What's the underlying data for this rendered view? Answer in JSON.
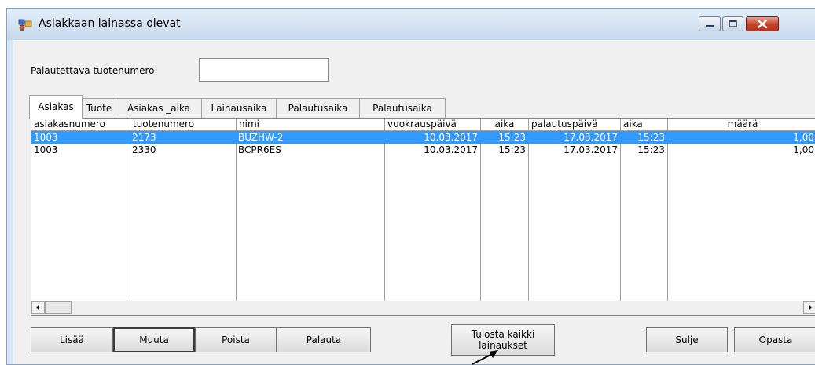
{
  "window": {
    "title": "Asiakkaan lainassa olevat",
    "app_icon": "people-icon",
    "controls": {
      "minimize": "minimize-icon",
      "maximize": "maximize-icon",
      "close": "close-icon"
    }
  },
  "product_input": {
    "label": "Palautettava tuotenumero:",
    "value": ""
  },
  "tabs": [
    {
      "label": "Asiakas",
      "active": true
    },
    {
      "label": "Tuote",
      "active": false
    },
    {
      "label": "Asiakas _aika",
      "active": false
    },
    {
      "label": "Lainausaika",
      "active": false
    },
    {
      "label": "Palautusaika",
      "active": false
    },
    {
      "label": "Palautusaika",
      "active": false
    }
  ],
  "grid": {
    "columns": [
      "asiakasnumero",
      "tuotenumero",
      "nimi",
      "vuokrauspäivä",
      "aika",
      "palautuspäivä",
      "aika",
      "määrä"
    ],
    "rows": [
      {
        "selected": true,
        "cells": [
          "1003",
          "2173",
          "BUZHW-2",
          "10.03.2017",
          "15:23",
          "17.03.2017",
          "15:23",
          "1,00"
        ]
      },
      {
        "selected": false,
        "cells": [
          "1003",
          "2330",
          "BCPR6ES",
          "10.03.2017",
          "15:23",
          "17.03.2017",
          "15:23",
          "1,00"
        ]
      }
    ],
    "scroll_left_icon": "arrow-left-icon",
    "scroll_right_icon": "arrow-right-icon"
  },
  "buttons": {
    "lisaa": "Lisää",
    "muuta": "Muuta",
    "poista": "Poista",
    "palauta": "Palauta",
    "tulosta_line1": "Tulosta kaikki",
    "tulosta_line2": "lainaukset",
    "sulje": "Sulje",
    "opasta": "Opasta"
  },
  "colors": {
    "selection": "#3399ff",
    "title_gradient_top": "#e4eefa",
    "title_gradient_bottom": "#c7d8ec",
    "close_button": "#c3432a"
  }
}
